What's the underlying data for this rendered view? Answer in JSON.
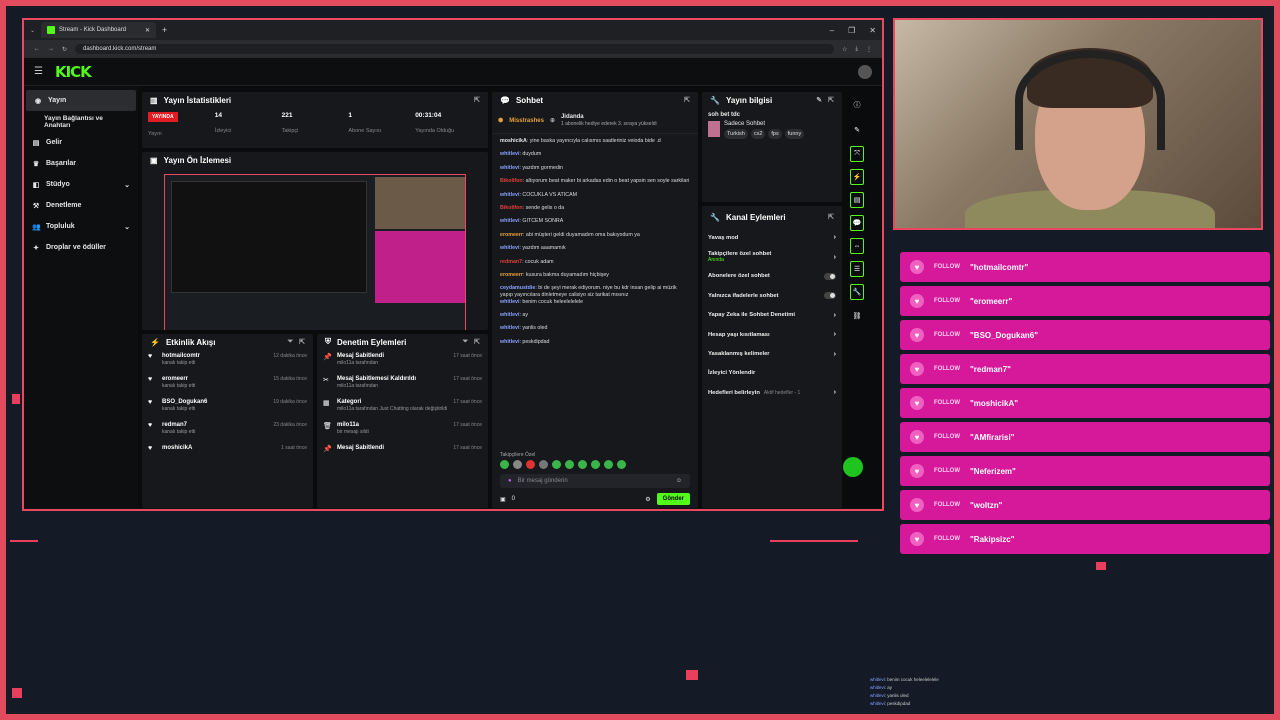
{
  "browser": {
    "tab_title": "Stream - Kick Dashboard",
    "url": "dashboard.kick.com/stream"
  },
  "header": {
    "logo": "KICK"
  },
  "sidebar": {
    "items": [
      {
        "label": "Yayın",
        "icon": "broadcast-icon"
      },
      {
        "label": "Yayın Bağlantısı ve Anahtarı",
        "icon": ""
      },
      {
        "label": "Gelir",
        "icon": "money-icon"
      },
      {
        "label": "Başarılar",
        "icon": "trophy-icon"
      },
      {
        "label": "Stüdyo",
        "icon": "studio-icon"
      },
      {
        "label": "Denetleme",
        "icon": "hammer-icon"
      },
      {
        "label": "Topluluk",
        "icon": "people-icon"
      },
      {
        "label": "Droplar ve ödüller",
        "icon": "gift-icon"
      }
    ]
  },
  "stats": {
    "title": "Yayın İstatistikleri",
    "live_badge": "YAYINDA",
    "items": [
      {
        "value": "",
        "label": "Yayın"
      },
      {
        "value": "14",
        "label": "İzleyici"
      },
      {
        "value": "221",
        "label": "Takipçi"
      },
      {
        "value": "1",
        "label": "Abone Sayısı"
      },
      {
        "value": "00:31:04",
        "label": "Yayında Olduğu"
      }
    ]
  },
  "preview": {
    "title": "Yayın Ön İzlemesi"
  },
  "activity": {
    "title": "Etkinlik Akışı",
    "items": [
      {
        "name": "hotmailcomtr",
        "sub": "kanalı takip etti",
        "time": "12 dakika önce"
      },
      {
        "name": "eromeerr",
        "sub": "kanalı takip etti",
        "time": "15 dakika önce"
      },
      {
        "name": "BSO_Dogukan6",
        "sub": "kanalı takip etti",
        "time": "19 dakika önce"
      },
      {
        "name": "redman7",
        "sub": "kanalı takip etti",
        "time": "23 dakika önce"
      },
      {
        "name": "moshicikA",
        "sub": "",
        "time": "1 saat önce"
      }
    ]
  },
  "modactions": {
    "title": "Denetim Eylemleri",
    "items": [
      {
        "name": "Mesaj Sabitlendi",
        "sub": "milo11a tarafından",
        "time": "17 saat önce",
        "icon": "pin-icon"
      },
      {
        "name": "Mesaj Sabitlemesi Kaldırıldı",
        "sub": "milo11a tarafından",
        "time": "17 saat önce",
        "icon": "unpin-icon"
      },
      {
        "name": "Kategori",
        "sub": "milo11a tarafından Just Chatting olarak değiştirildi",
        "time": "17 saat önce",
        "icon": "category-icon"
      },
      {
        "name": "milo11a",
        "sub": "bir mesajı sildi",
        "time": "17 saat önce",
        "icon": "trash-icon"
      },
      {
        "name": "Mesaj Sabitlendi",
        "sub": "",
        "time": "17 saat önce",
        "icon": "pin-icon"
      }
    ]
  },
  "chat": {
    "title": "Sohbet",
    "pinned_user": "Misstrashes",
    "pinned_gift_user": "Jidanda",
    "pinned_text": "1 abonelik hediye ederek 3. sıraya yükseldi",
    "messages": [
      {
        "user": "moshicikA",
        "color": "#e6e6e6",
        "text": ": yine baska yayıncıyla calısmıs saatleriniz veioda bide .d"
      },
      {
        "user": "whitlevi",
        "color": "#8aa0ff",
        "text": ": duydum"
      },
      {
        "user": "whitlevi",
        "color": "#8aa0ff",
        "text": ": yazdım gormedin"
      },
      {
        "user": "Bikolifon",
        "color": "#e0403a",
        "text": ": altıyorum beat maker bi arkadas edin o beat yapsin sen soyle sarkilari"
      },
      {
        "user": "whitlevi",
        "color": "#8aa0ff",
        "text": ": COCUKLA VS ATICAM"
      },
      {
        "user": "Bikolifon",
        "color": "#e0403a",
        "text": ": sende gelis o da"
      },
      {
        "user": "whitlevi",
        "color": "#8aa0ff",
        "text": ": GITCEM SONRA"
      },
      {
        "user": "eromeerr",
        "color": "#e6a23c",
        "text": ": abi müşteri geldi duyamadım oma bakıyodum ya"
      },
      {
        "user": "whitlevi",
        "color": "#8aa0ff",
        "text": ": yazdım aaamamık"
      },
      {
        "user": "redman7",
        "color": "#e0403a",
        "text": ": cocuk adam"
      },
      {
        "user": "eromeerr",
        "color": "#e6a23c",
        "text": ": kusura bakma duyamadım hiçbişey"
      },
      {
        "user": "ceydamustdie",
        "color": "#8aa0ff",
        "text": ": bi de şeyi merak ediyorum. niye bu kdr insan gelip ai müzik yapıp yayıncılara dinletmeye calisiyo siz tarikat mısınız"
      },
      {
        "user": "whitlevi",
        "color": "#8aa0ff",
        "text": ": benim cocuk heleelelelele"
      },
      {
        "user": "whitlevi",
        "color": "#8aa0ff",
        "text": ": ay"
      },
      {
        "user": "whitlevi",
        "color": "#8aa0ff",
        "text": ": yanlis oled"
      },
      {
        "user": "whitlevi",
        "color": "#8aa0ff",
        "text": ": peskdipdad"
      }
    ],
    "emote_label": "Takipçilere Özel",
    "input_placeholder": "Bir mesaj gönderin",
    "count": "0",
    "send_label": "Gönder"
  },
  "info": {
    "title": "Yayın bilgisi",
    "stream_title": "soh bet tdc",
    "category": "Sadece Sohbet",
    "tags": [
      "Turkish",
      "cs2",
      "fps",
      "funny"
    ]
  },
  "channel_actions": {
    "title": "Kanal Eylemleri",
    "items": [
      {
        "label": "Yavaş mod",
        "sub": "",
        "control": "chevron"
      },
      {
        "label": "Takipçilere özel sohbet",
        "sub": "Anında",
        "control": "chevron"
      },
      {
        "label": "Abonelere özel sohbet",
        "sub": "",
        "control": "toggle"
      },
      {
        "label": "Yalnızca ifadelerle sohbet",
        "sub": "",
        "control": "toggle"
      },
      {
        "label": "Yapay Zeka ile Sohbet Denetimi",
        "sub": "",
        "control": "chevron"
      },
      {
        "label": "Hesap yaşı kısıtlaması",
        "sub": "",
        "control": "chevron"
      },
      {
        "label": "Yasaklanmış kelimeler",
        "sub": "",
        "control": "chevron"
      },
      {
        "label": "İzleyici Yönlendir",
        "sub": "",
        "control": "none"
      },
      {
        "label": "Hedefleri belirleyin",
        "sub": "Aktif hedefler - 1",
        "control": "chevron"
      }
    ]
  },
  "followers": [
    {
      "label": "FOLLOW",
      "name": "\"hotmailcomtr\""
    },
    {
      "label": "FOLLOW",
      "name": "\"eromeerr\""
    },
    {
      "label": "FOLLOW",
      "name": "\"BSO_Dogukan6\""
    },
    {
      "label": "FOLLOW",
      "name": "\"redman7\""
    },
    {
      "label": "FOLLOW",
      "name": "\"moshicikA\""
    },
    {
      "label": "FOLLOW",
      "name": "\"AMfirarisi\""
    },
    {
      "label": "FOLLOW",
      "name": "\"Neferizem\""
    },
    {
      "label": "FOLLOW",
      "name": "\"woltzn\""
    },
    {
      "label": "FOLLOW",
      "name": "\"Rakipsizc\""
    }
  ],
  "overlay_chat": [
    {
      "user": "whitlevi",
      "text": ": benim cocuk heleelelelele"
    },
    {
      "user": "whitlevi",
      "text": ": ay"
    },
    {
      "user": "whitlevi",
      "text": ": yanlis oled"
    },
    {
      "user": "whitlevi",
      "text": ": peskdipdad"
    }
  ],
  "colors": {
    "accent": "#53fc18",
    "frame": "#e84860",
    "follow_bg": "#d6199a"
  }
}
